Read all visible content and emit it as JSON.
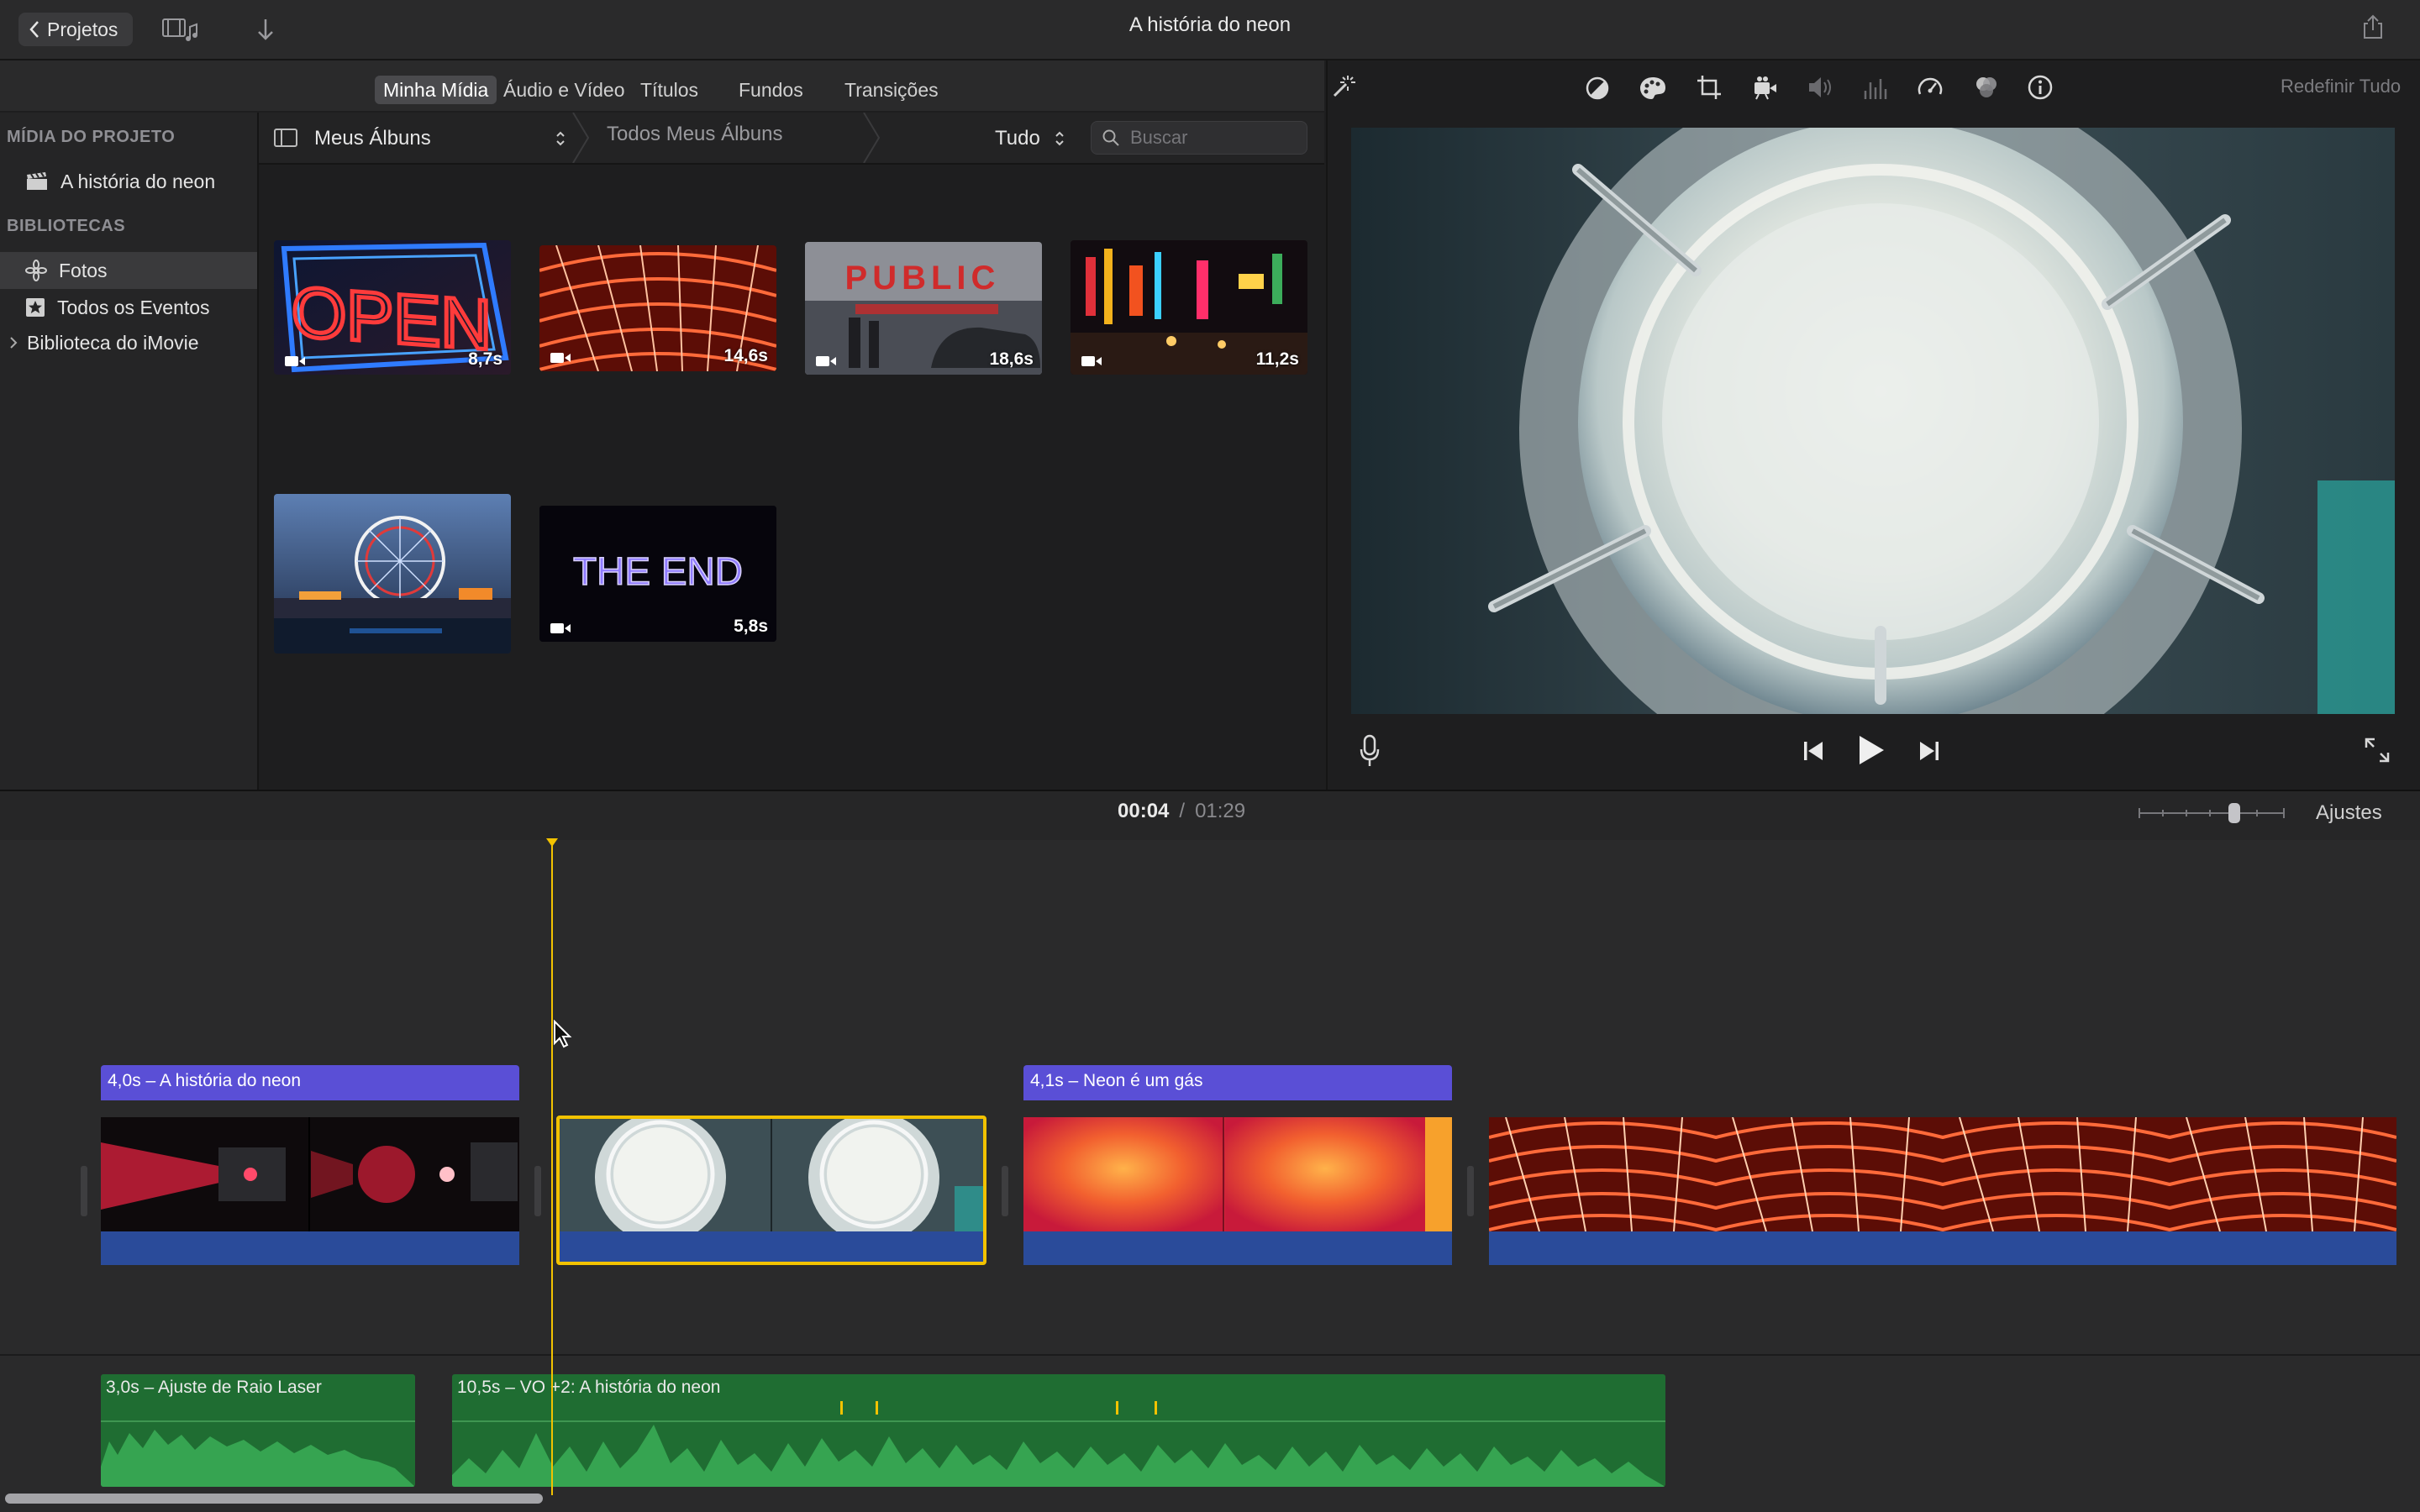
{
  "window": {
    "title": "A história do neon"
  },
  "toolbar": {
    "back_label": "Projetos"
  },
  "browser_tabs": [
    "Minha Mídia",
    "Áudio e Vídeo",
    "Títulos",
    "Fundos",
    "Transições"
  ],
  "sidebar": {
    "project_heading": "MÍDIA DO PROJETO",
    "project_item": "A história do neon",
    "libraries_heading": "BIBLIOTECAS",
    "items": [
      "Fotos",
      "Todos os Eventos",
      "Biblioteca do iMovie"
    ]
  },
  "album_bar": {
    "album": "Meus Álbuns",
    "breadcrumb": "Todos Meus Álbuns",
    "filter": "Tudo",
    "search_placeholder": "Buscar"
  },
  "media": [
    {
      "name": "open-sign",
      "duration": "8,7s"
    },
    {
      "name": "red-neon-tunnel",
      "duration": "14,6s"
    },
    {
      "name": "public-market",
      "duration": "18,6s"
    },
    {
      "name": "city-street",
      "duration": "11,2s"
    },
    {
      "name": "ferris-wheel",
      "duration": ""
    },
    {
      "name": "the-end",
      "duration": "5,8s"
    }
  ],
  "thumb_texts": {
    "open": "OPEN",
    "public": "PUBLIC",
    "the_end": "THE END"
  },
  "viewer": {
    "reset_label": "Redefinir Tudo"
  },
  "timeline": {
    "current_time": "00:04",
    "separator": "/",
    "total_time": "01:29",
    "settings_label": "Ajustes",
    "titles": [
      "4,0s – A história do neon",
      "4,1s – Neon é um gás"
    ],
    "audio_clips": [
      "3,0s – Ajuste de Raio Laser",
      "10,5s – VO +2: A história do neon"
    ]
  },
  "colors": {
    "selection": "#f2c200",
    "playhead": "#f2c200",
    "title_clip": "#5a4fd6",
    "audio_clip": "#1f6d32",
    "video_audio_strip": "#2a4b9a"
  }
}
